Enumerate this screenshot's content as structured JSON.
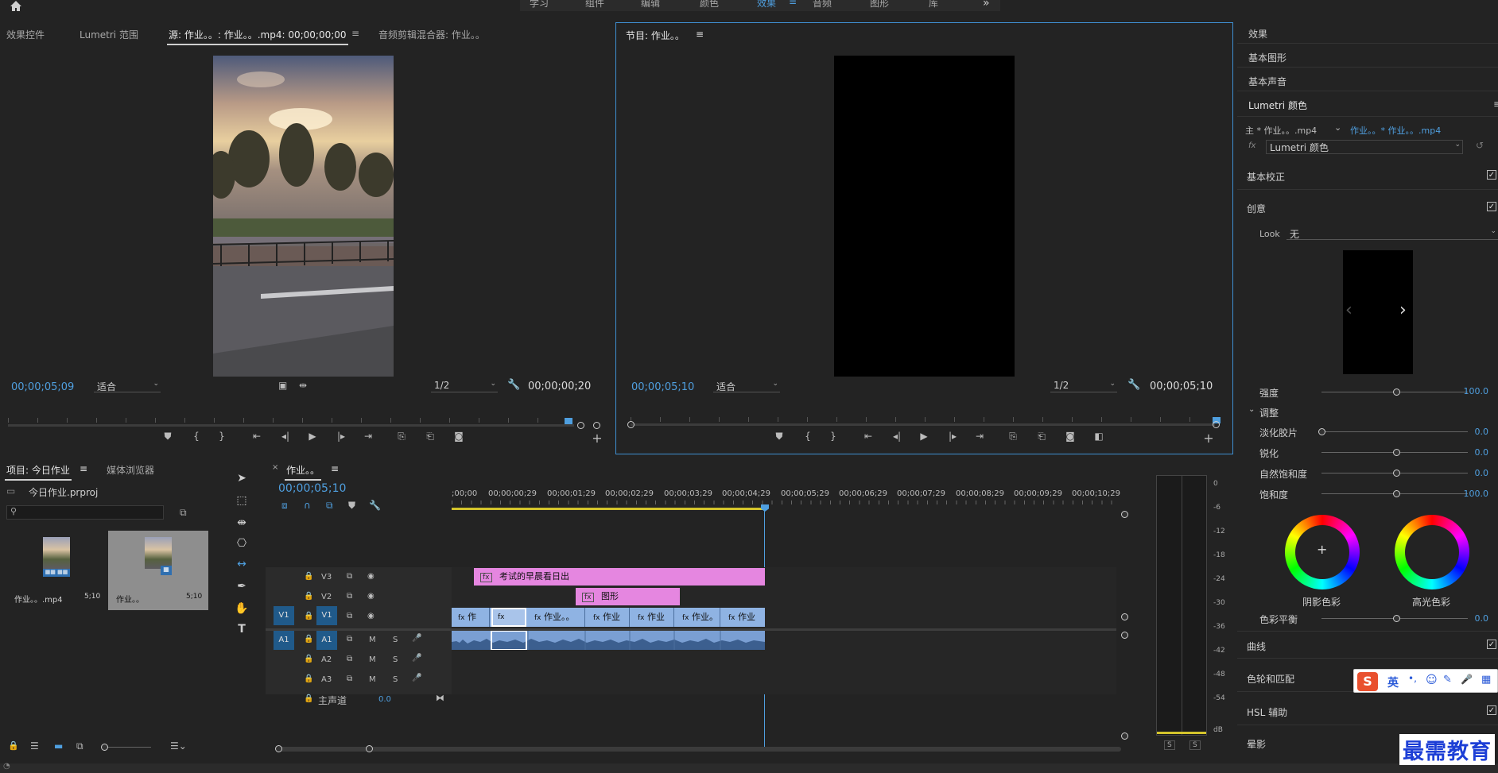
{
  "workspace_tabs": [
    "学习",
    "组件",
    "编辑",
    "颜色",
    "效果",
    "音频",
    "图形",
    "库"
  ],
  "workspace_active_index": 4,
  "source_panel": {
    "tabs": [
      "效果控件",
      "Lumetri 范围",
      "源: 作业。。: 作业。。.mp4: 00;00;00;00",
      "音频剪辑混合器: 作业。。"
    ],
    "timecode": "00;00;05;09",
    "fit": "适合",
    "resolution": "1/2",
    "duration": "00;00;00;20"
  },
  "program_panel": {
    "title": "节目: 作业。。",
    "timecode": "00;00;05;10",
    "fit": "适合",
    "resolution": "1/2",
    "duration": "00;00;05;10"
  },
  "project_panel": {
    "tabs": [
      "项目: 今日作业",
      "媒体浏览器"
    ],
    "project_file": "今日作业.prproj",
    "search_placeholder": "",
    "items": [
      {
        "name": "作业。。.mp4",
        "duration": "5;10"
      },
      {
        "name": "作业。。",
        "duration": "5;10"
      }
    ]
  },
  "timeline": {
    "tab": "作业。。",
    "timecode": "00;00;05;10",
    "ruler": [
      ";00;00",
      "00;00;00;29",
      "00;00;01;29",
      "00;00;02;29",
      "00;00;03;29",
      "00;00;04;29",
      "00;00;05;29",
      "00;00;06;29",
      "00;00;07;29",
      "00;00;08;29",
      "00;00;09;29",
      "00;00;10;29"
    ],
    "tracks": {
      "v3": "V3",
      "v2": "V2",
      "v1": "V1",
      "v1_src": "V1",
      "a1": "A1",
      "a1_src": "A1",
      "a2": "A2",
      "a3": "A3",
      "master": "主声道",
      "master_val": "0.0"
    },
    "clips": {
      "v3_title": "考试的早晨看日出",
      "v2_title": "图形",
      "v1_clips": [
        "作",
        "",
        "作业。。",
        "作业",
        "作业",
        "作业。",
        "作业"
      ]
    },
    "track_btn_m": "M",
    "track_btn_s": "S"
  },
  "meter": {
    "labels": [
      "0",
      "-6",
      "-12",
      "-18",
      "-24",
      "-30",
      "-36",
      "-42",
      "-48",
      "-54",
      "dB"
    ],
    "solo": [
      "S",
      "S"
    ]
  },
  "right_panel": {
    "sections": [
      "效果",
      "基本图形",
      "基本声音",
      "Lumetri 颜色"
    ],
    "master_clip": "主 * 作业。。.mp4",
    "seq_clip": "作业。。* 作业。。.mp4",
    "fx_name": "Lumetri 颜色",
    "basic_correction": "基本校正",
    "creative": "创意",
    "look_label": "Look",
    "look_value": "无",
    "intensity_label": "强度",
    "intensity_value": "100.0",
    "adjust_label": "调整",
    "faded_film_label": "淡化胶片",
    "faded_film_value": "0.0",
    "sharpen_label": "锐化",
    "sharpen_value": "0.0",
    "vibrance_label": "自然饱和度",
    "vibrance_value": "0.0",
    "saturation_label": "饱和度",
    "saturation_value": "100.0",
    "shadow_tint": "阴影色彩",
    "highlight_tint": "高光色彩",
    "color_balance_label": "色彩平衡",
    "color_balance_value": "0.0",
    "curves": "曲线",
    "wheels": "色轮和匹配",
    "hsl": "HSL 辅助",
    "vignette": "晕影"
  },
  "ime_toolbar": {
    "lang": "英",
    "items": [
      "•,",
      "☺",
      "✎",
      "🎤",
      "▦"
    ]
  },
  "watermark": "最需教育",
  "colors": {
    "accent": "#4f9fdf",
    "title_clip": "#e586e0",
    "video_clip": "#8fb3e3",
    "audio_clip": "#7a9fd3",
    "track_sel": "#205a8a"
  }
}
